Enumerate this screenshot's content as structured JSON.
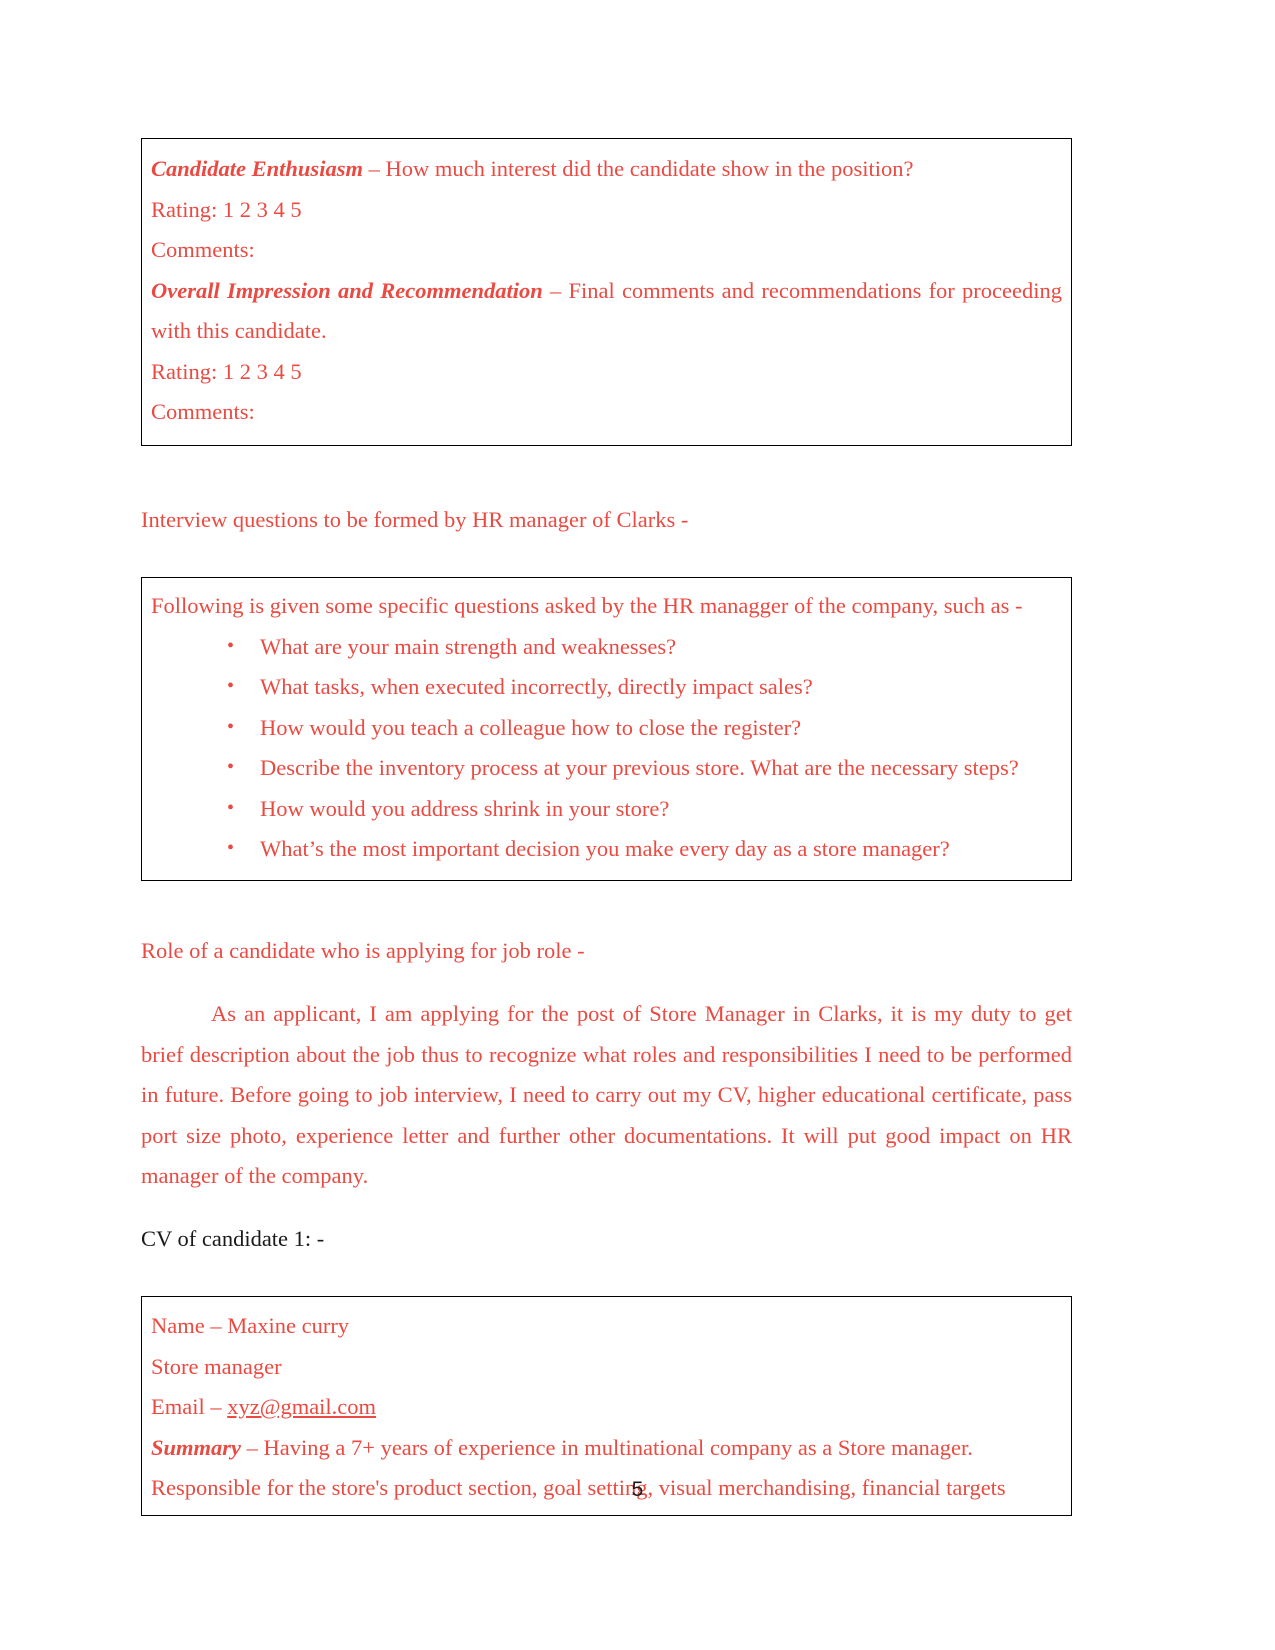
{
  "page": {
    "number": "5",
    "text_color": "#ea4a41",
    "black_color": "#1a1a1a",
    "border_color": "#000000"
  },
  "box_evaluation": {
    "candidate_enthusiasm": {
      "label": "Candidate Enthusiasm",
      "dash": " – ",
      "text": "How much interest did the candidate show in the position?"
    },
    "rating_label_1": "Rating:",
    "rating_values_1": "1  2   3    4     5",
    "comments_label_1": "Comments:",
    "overall_impression": {
      "label": "Overall Impression and Recommendation",
      "dash": " – ",
      "text": "Final comments and recommendations for proceeding with this candidate."
    },
    "rating_label_2": "Rating:",
    "rating_values_2": "1  2   3    4     5",
    "comments_label_2": "Comments:"
  },
  "section_interview_questions": {
    "heading": "Interview questions to be formed by HR manager of Clarks -",
    "intro": "Following is given some specific questions asked by the HR managger of the company, such as -",
    "questions": [
      "What are your main strength and weaknesses?",
      "What tasks, when executed incorrectly, directly impact sales?",
      "How would you teach a colleague how to close the register?",
      "Describe the inventory process at your previous store. What are the necessary steps?",
      "How would you address shrink in your store?",
      "What’s the most important decision you make every day as a store manager?"
    ]
  },
  "section_role": {
    "heading": "Role of a candidate who is applying for job role -",
    "paragraph": "As an applicant, I am applying for the post of Store Manager in Clarks, it is my duty to get brief description about the job thus to recognize what roles and responsibilities I need to be performed in future. Before going to job interview, I need to carry out my CV, higher educational certificate, pass port size photo, experience letter and further other documentations. It will put good impact on HR manager of the company."
  },
  "section_cv": {
    "heading": "CV of candidate 1: -",
    "name_label": "Name – ",
    "name_value": "Maxine curry",
    "job_title": "Store manager",
    "email_label": "Email – ",
    "email_value": "xyz@gmail.com",
    "summary_label": "Summary",
    "summary_dash": " – ",
    "summary_text": "Having a 7+ years of experience in multinational company as a Store manager.",
    "responsibility_text": "Responsible for the store's product section, goal setting, visual merchandising, financial targets"
  }
}
